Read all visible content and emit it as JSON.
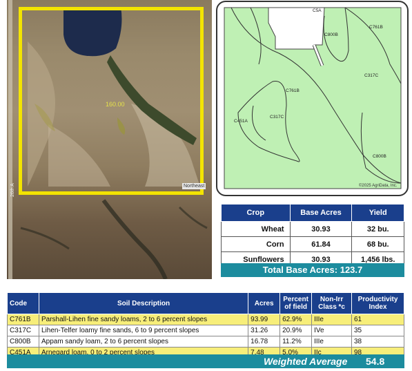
{
  "aerial": {
    "acres_label": "160.00",
    "caption": "Northeast",
    "road_label": "26th A"
  },
  "soil_map": {
    "labels": [
      "C5A",
      "C800B",
      "C761B",
      "C317C",
      "C761B",
      "C451A",
      "C317C",
      "C800B"
    ],
    "copyright": "©2025 AgriData, Inc."
  },
  "crop_table": {
    "headers": [
      "Crop",
      "Base Acres",
      "Yield"
    ],
    "rows": [
      {
        "crop": "Wheat",
        "acres": "30.93",
        "yield": "32 bu."
      },
      {
        "crop": "Corn",
        "acres": "61.84",
        "yield": "68 bu."
      },
      {
        "crop": "Sunflowers",
        "acres": "30.93",
        "yield": "1,456 lbs."
      }
    ],
    "total_label": "Total Base Acres:",
    "total_value": "123.7"
  },
  "soil_table": {
    "headers": [
      "Code",
      "Soil Description",
      "Acres",
      "Percent of field",
      "Non-Irr Class *c",
      "Productivity Index"
    ],
    "rows": [
      {
        "code": "C761B",
        "desc": "Parshall-Lihen fine sandy loams, 2 to 6 percent slopes",
        "acres": "93.99",
        "pct": "62.9%",
        "cls": "IIIe",
        "pi": "61",
        "highlight": true
      },
      {
        "code": "C317C",
        "desc": "Lihen-Telfer loamy fine sands, 6 to 9 percent slopes",
        "acres": "31.26",
        "pct": "20.9%",
        "cls": "IVe",
        "pi": "35",
        "highlight": false
      },
      {
        "code": "C800B",
        "desc": "Appam sandy loam, 2 to 6 percent slopes",
        "acres": "16.78",
        "pct": "11.2%",
        "cls": "IIIe",
        "pi": "38",
        "highlight": false
      },
      {
        "code": "C451A",
        "desc": "Arnegard loam, 0 to 2 percent slopes",
        "acres": "7.48",
        "pct": "5.0%",
        "cls": "IIc",
        "pi": "98",
        "highlight": true
      }
    ],
    "weighted_label": "Weighted Average",
    "weighted_value": "54.8"
  },
  "colors": {
    "header_blue": "#1a3f8c",
    "total_teal": "#1c8c9e",
    "highlight_yellow": "#f7ee7a",
    "field_outline": "#f3e400",
    "soil_fill": "#bff0b4"
  }
}
